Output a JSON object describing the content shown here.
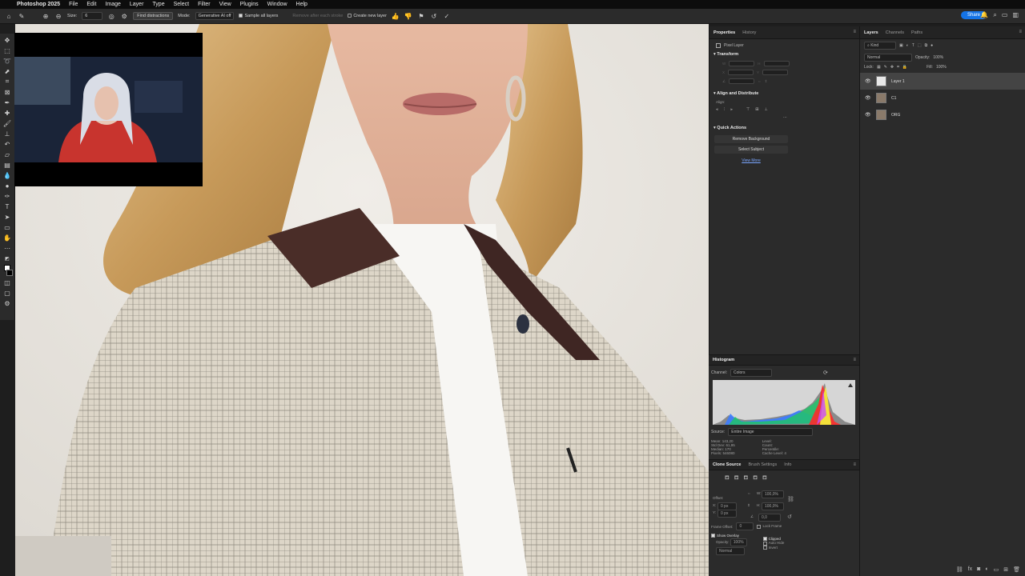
{
  "menubar": {
    "apple": "",
    "app_name": "Photoshop 2025",
    "items": [
      "File",
      "Edit",
      "Image",
      "Layer",
      "Type",
      "Select",
      "Filter",
      "View",
      "Plugins",
      "Window",
      "Help"
    ]
  },
  "options_bar": {
    "size_label": "Size:",
    "size_value": "6",
    "find_distractions": "Find distractions",
    "mode_label": "Mode:",
    "mode_value": "Generative AI off",
    "sample_all_layers": "Sample all layers",
    "remove_after_stroke": "Remove after each stroke",
    "create_new_layer": "Create new layer",
    "share_label": "Share"
  },
  "properties_panel": {
    "tabs": [
      "Properties",
      "History"
    ],
    "pixel_layer": "Pixel Layer",
    "transform_title": "Transform",
    "transform_fields": [
      "W",
      "H",
      "X",
      "Y"
    ],
    "align_title": "Align and Distribute",
    "align_label": "Align:",
    "quick_actions_title": "Quick Actions",
    "remove_background": "Remove Background",
    "select_subject": "Select Subject",
    "view_more": "View More"
  },
  "histogram_panel": {
    "title": "Histogram",
    "channel_label": "Channel:",
    "channel_value": "Colors",
    "source_label": "Source:",
    "source_value": "Entire Image",
    "stats_left": [
      {
        "label": "Mean:",
        "value": "143,20"
      },
      {
        "label": "Std Dev:",
        "value": "61,95"
      },
      {
        "label": "Median:",
        "value": "170"
      },
      {
        "label": "Pixels:",
        "value": "546080"
      }
    ],
    "stats_right": [
      {
        "label": "Level:",
        "value": ""
      },
      {
        "label": "Count:",
        "value": ""
      },
      {
        "label": "Percentile:",
        "value": ""
      },
      {
        "label": "Cache Level:",
        "value": "4"
      }
    ]
  },
  "clone_panel": {
    "tabs": [
      "Clone Source",
      "Brush Settings",
      "Info"
    ],
    "offset_label": "Offset:",
    "x_label": "X:",
    "x_value": "0 px",
    "y_label": "Y:",
    "y_value": "0 px",
    "w_label": "W:",
    "w_value": "100,0%",
    "h_label": "H:",
    "h_value": "100,0%",
    "angle_value": "0,0",
    "frame_offset_label": "Frame Offset:",
    "frame_offset_value": "0",
    "lock_frame": "Lock Frame",
    "show_overlay": "Show Overlay",
    "opacity_label": "Opacity:",
    "opacity_value": "100%",
    "blend_value": "Normal",
    "clipped": "Clipped",
    "auto_hide": "Auto Hide",
    "invert": "Invert"
  },
  "layers_panel": {
    "tabs": [
      "Layers",
      "Channels",
      "Paths"
    ],
    "kind_label": "Kind",
    "blend_mode": "Normal",
    "opacity_label": "Opacity:",
    "opacity_value": "100%",
    "lock_label": "Lock:",
    "fill_label": "Fill:",
    "fill_value": "100%",
    "layers": [
      {
        "name": "Layer 1",
        "selected": true,
        "thumb": "#e8e8e8"
      },
      {
        "name": "C1",
        "selected": false,
        "thumb": "#8a7a6a"
      },
      {
        "name": "ORG",
        "selected": false,
        "thumb": "#8a7a6a"
      }
    ]
  },
  "colors": {
    "accent": "#1473e6",
    "panel_bg": "#2b2b2b"
  }
}
